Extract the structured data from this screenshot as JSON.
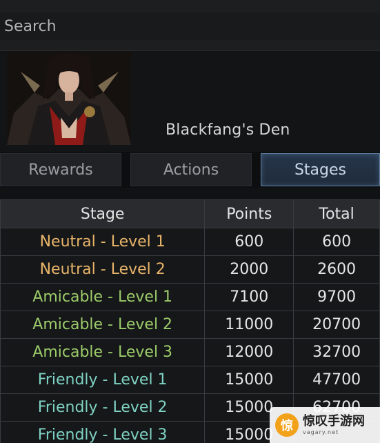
{
  "search": {
    "placeholder": "Search"
  },
  "npc": {
    "name": "Blackfang's Den",
    "portrait": "pirate-captain-portrait"
  },
  "tabs": [
    {
      "label": "Rewards",
      "active": false
    },
    {
      "label": "Actions",
      "active": false
    },
    {
      "label": "Stages",
      "active": true
    }
  ],
  "table": {
    "headers": [
      "Stage",
      "Points",
      "Total"
    ],
    "rows": [
      {
        "stage": "Neutral - Level 1",
        "points": "600",
        "total": "600",
        "color": "#e8b56a"
      },
      {
        "stage": "Neutral - Level 2",
        "points": "2000",
        "total": "2600",
        "color": "#e8b56a"
      },
      {
        "stage": "Amicable - Level 1",
        "points": "7100",
        "total": "9700",
        "color": "#9ccc6a"
      },
      {
        "stage": "Amicable - Level 2",
        "points": "11000",
        "total": "20700",
        "color": "#9ccc6a"
      },
      {
        "stage": "Amicable - Level 3",
        "points": "12000",
        "total": "32700",
        "color": "#9ccc6a"
      },
      {
        "stage": "Friendly - Level 1",
        "points": "15000",
        "total": "47700",
        "color": "#7fd3c4"
      },
      {
        "stage": "Friendly - Level 2",
        "points": "15000",
        "total": "62700",
        "color": "#7fd3c4"
      },
      {
        "stage": "Friendly - Level 3",
        "points": "15000",
        "total": "",
        "color": "#7fd3c4"
      }
    ]
  },
  "watermark": {
    "title": "惊叹手游网",
    "sub": "vagary.net",
    "logo": "惊"
  }
}
